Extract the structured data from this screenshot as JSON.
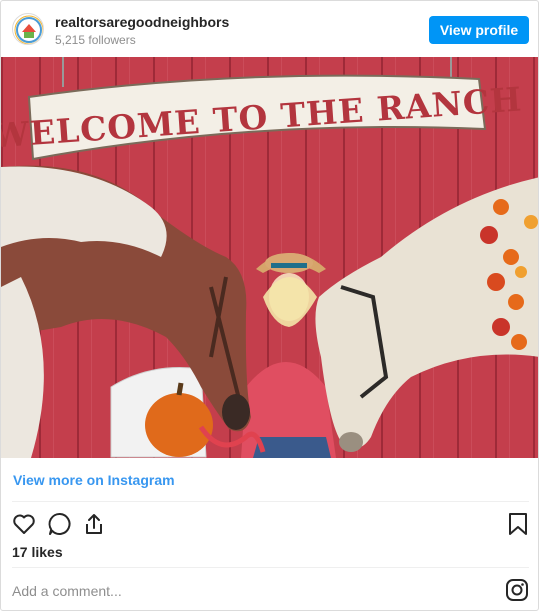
{
  "header": {
    "username": "realtorsaregoodneighbors",
    "followers": "5,215 followers",
    "view_profile_label": "View profile"
  },
  "post": {
    "sign_text": "WELCOME TO THE RANCH",
    "view_more_label": "View more on Instagram",
    "likes": "17 likes"
  },
  "comment": {
    "placeholder": "Add a comment..."
  },
  "icons": {
    "like": "heart-icon",
    "comment": "comment-icon",
    "share": "share-icon",
    "save": "bookmark-icon",
    "instagram": "instagram-logo-icon"
  },
  "colors": {
    "primary_button": "#0095f6",
    "link": "#3897f0",
    "barn_red": "#c9404f"
  }
}
